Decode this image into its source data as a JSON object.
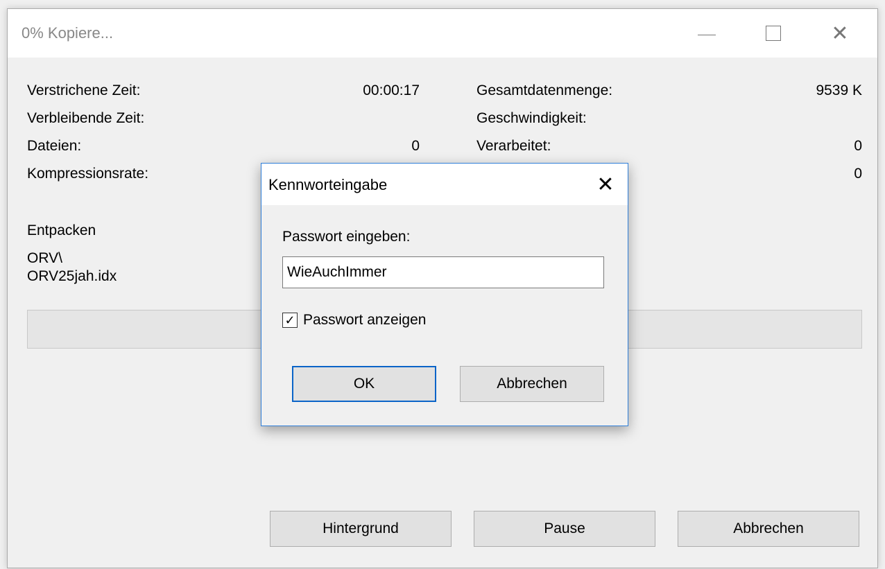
{
  "window": {
    "title": "0% Kopiere...",
    "controls": {
      "minimize": "minimize-icon",
      "maximize": "maximize-icon",
      "close": "close-icon"
    }
  },
  "stats": {
    "left": [
      {
        "label": "Verstrichene Zeit:",
        "value": "00:00:17"
      },
      {
        "label": "Verbleibende Zeit:",
        "value": ""
      },
      {
        "label": "Dateien:",
        "value": "0"
      },
      {
        "label": "Kompressionsrate:",
        "value": ""
      }
    ],
    "right": [
      {
        "label": "Gesamtdatenmenge:",
        "value": "9539 K"
      },
      {
        "label": "Geschwindigkeit:",
        "value": ""
      },
      {
        "label": "Verarbeitet:",
        "value": "0"
      },
      {
        "label": "",
        "value": "0"
      }
    ]
  },
  "operation": {
    "label": "Entpacken",
    "folder": "ORV\\",
    "file": "ORV25jah.idx"
  },
  "progress": {
    "percent": 0
  },
  "buttons": {
    "background": "Hintergrund",
    "pause": "Pause",
    "cancel": "Abbrechen"
  },
  "dialog": {
    "title": "Kennworteingabe",
    "prompt": "Passwort eingeben:",
    "password_value": "WieAuchImmer",
    "show_password_label": "Passwort anzeigen",
    "show_password_checked": true,
    "ok": "OK",
    "cancel": "Abbrechen"
  },
  "colors": {
    "dialog_border": "#2f7ed8",
    "focus_border": "#0a64c8",
    "button_face": "#e1e1e1"
  }
}
